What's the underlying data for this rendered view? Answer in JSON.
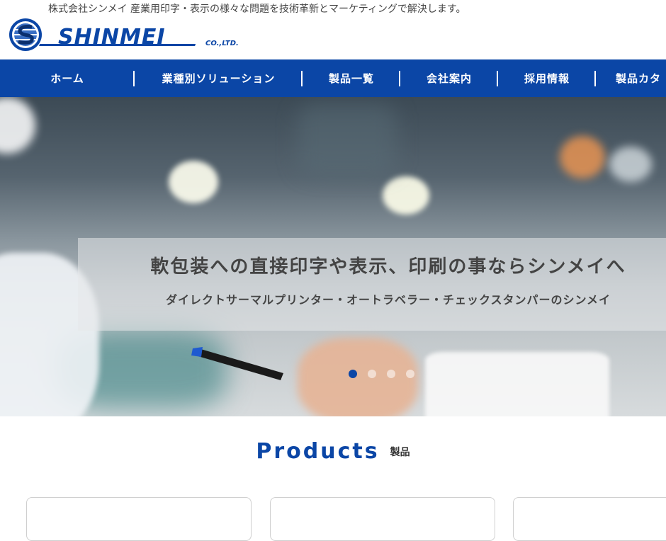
{
  "header": {
    "tagline": "株式会社シンメイ 産業用印字・表示の様々な問題を技術革新とマーケティングで解決します。",
    "logo_text": "SHINMEI",
    "logo_suffix": "CO.,LTD."
  },
  "nav": {
    "items": [
      {
        "label": "ホーム"
      },
      {
        "label": "業種別ソリューション"
      },
      {
        "label": "製品一覧"
      },
      {
        "label": "会社案内"
      },
      {
        "label": "採用情報"
      },
      {
        "label": "製品カタ"
      }
    ]
  },
  "hero": {
    "title": "軟包装への直接印字や表示、印刷の事ならシンメイへ",
    "subtitle": "ダイレクトサーマルプリンター・オートラベラー・チェックスタンパーのシンメイ",
    "slide_count": 4,
    "active_slide": 1
  },
  "products": {
    "title": "Products",
    "subtitle": "製品"
  },
  "colors": {
    "brand_blue": "#0b46a6",
    "nav_text": "#ffffff"
  }
}
